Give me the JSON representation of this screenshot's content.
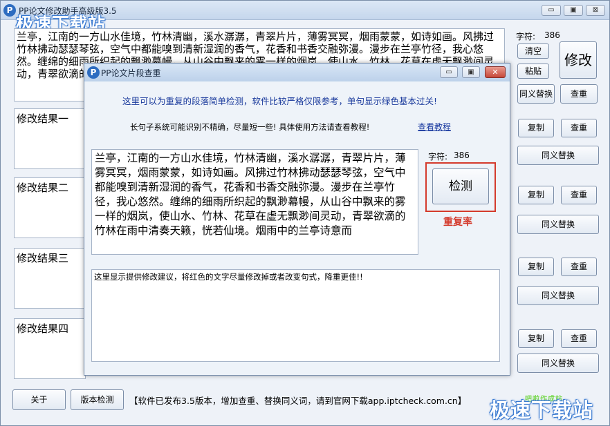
{
  "app": {
    "title": "PP论文修改助手高级版3.5",
    "logo": "P",
    "minimize": "▭",
    "maximize": "▣",
    "close": "⊠"
  },
  "watermark": {
    "text": "极速下载站",
    "small": "吧啦作成站"
  },
  "main": {
    "source_text": "兰亭，江南的一方山水佳境，竹林清幽，溪水潺潺，青翠片片，薄雾冥冥，烟雨蒙蒙，如诗如画。风拂过竹林拂动瑟瑟琴弦，空气中都能嗅到清新湿润的香气，花香和书香交融弥漫。漫步在兰亭竹径，我心悠然。缠绵的细雨所织起的飘渺幕幔，从山谷中飘来的雾一样的烟岚，使山水、竹林、花草在虚无飘渺间灵动，青翠欲滴的竹林在雨中清奏天籁，恍若仙境。烟雨中的兰亭诗意而细雨蒙蒙中我",
    "char_count_label": "字符:",
    "char_count": "386",
    "clear_button": "清空",
    "paste_button": "粘贴",
    "modify_button": "修改",
    "synonym_button": "同义替换",
    "check_button": "查重",
    "copy_button": "复制",
    "results": [
      {
        "label": "修改结果一"
      },
      {
        "label": "修改结果二"
      },
      {
        "label": "修改结果三"
      },
      {
        "label": "修改结果四"
      }
    ],
    "about_button": "关于",
    "version_button": "版本检测",
    "notice": "【软件已发布3.5版本，增加查重、替换同义词，请到官网下载app.iptcheck.com.cn】"
  },
  "dialog": {
    "title": "PP论文片段查重",
    "minimize": "▭",
    "maximize": "▣",
    "close": "✕",
    "header_text": "这里可以为重复的段落简单检测，软件比较严格仅限参考，单句显示绿色基本过关!",
    "hint_text": "长句子系统可能识别不精确，尽量短一些! 具体使用方法请查看教程!",
    "tutorial_link": "查看教程",
    "input_text": "兰亭，江南的一方山水佳境，竹林清幽，溪水潺潺，青翠片片，薄雾冥冥，烟雨蒙蒙，如诗如画。风拂过竹林拂动瑟瑟琴弦，空气中都能嗅到清新湿润的香气，花香和书香交融弥漫。漫步在兰亭竹径，我心悠然。缠绵的细雨所织起的飘渺幕幔，从山谷中飘来的雾一样的烟岚，使山水、竹林、花草在虚无飘渺间灵动，青翠欲滴的竹林在雨中清奏天籁，恍若仙境。烟雨中的兰亭诗意而",
    "char_count_label": "字符:",
    "char_count": "386",
    "detect_button": "检测",
    "dup_rate_label": "重复率",
    "suggestion_text": "这里显示提供修改建议，将红色的文字尽量修改掉或者改变句式，降重更佳!!"
  },
  "colors": {
    "accent_blue": "#1a3a9c",
    "highlight_red": "#d43a2c",
    "link_blue": "#1a3aa0"
  }
}
